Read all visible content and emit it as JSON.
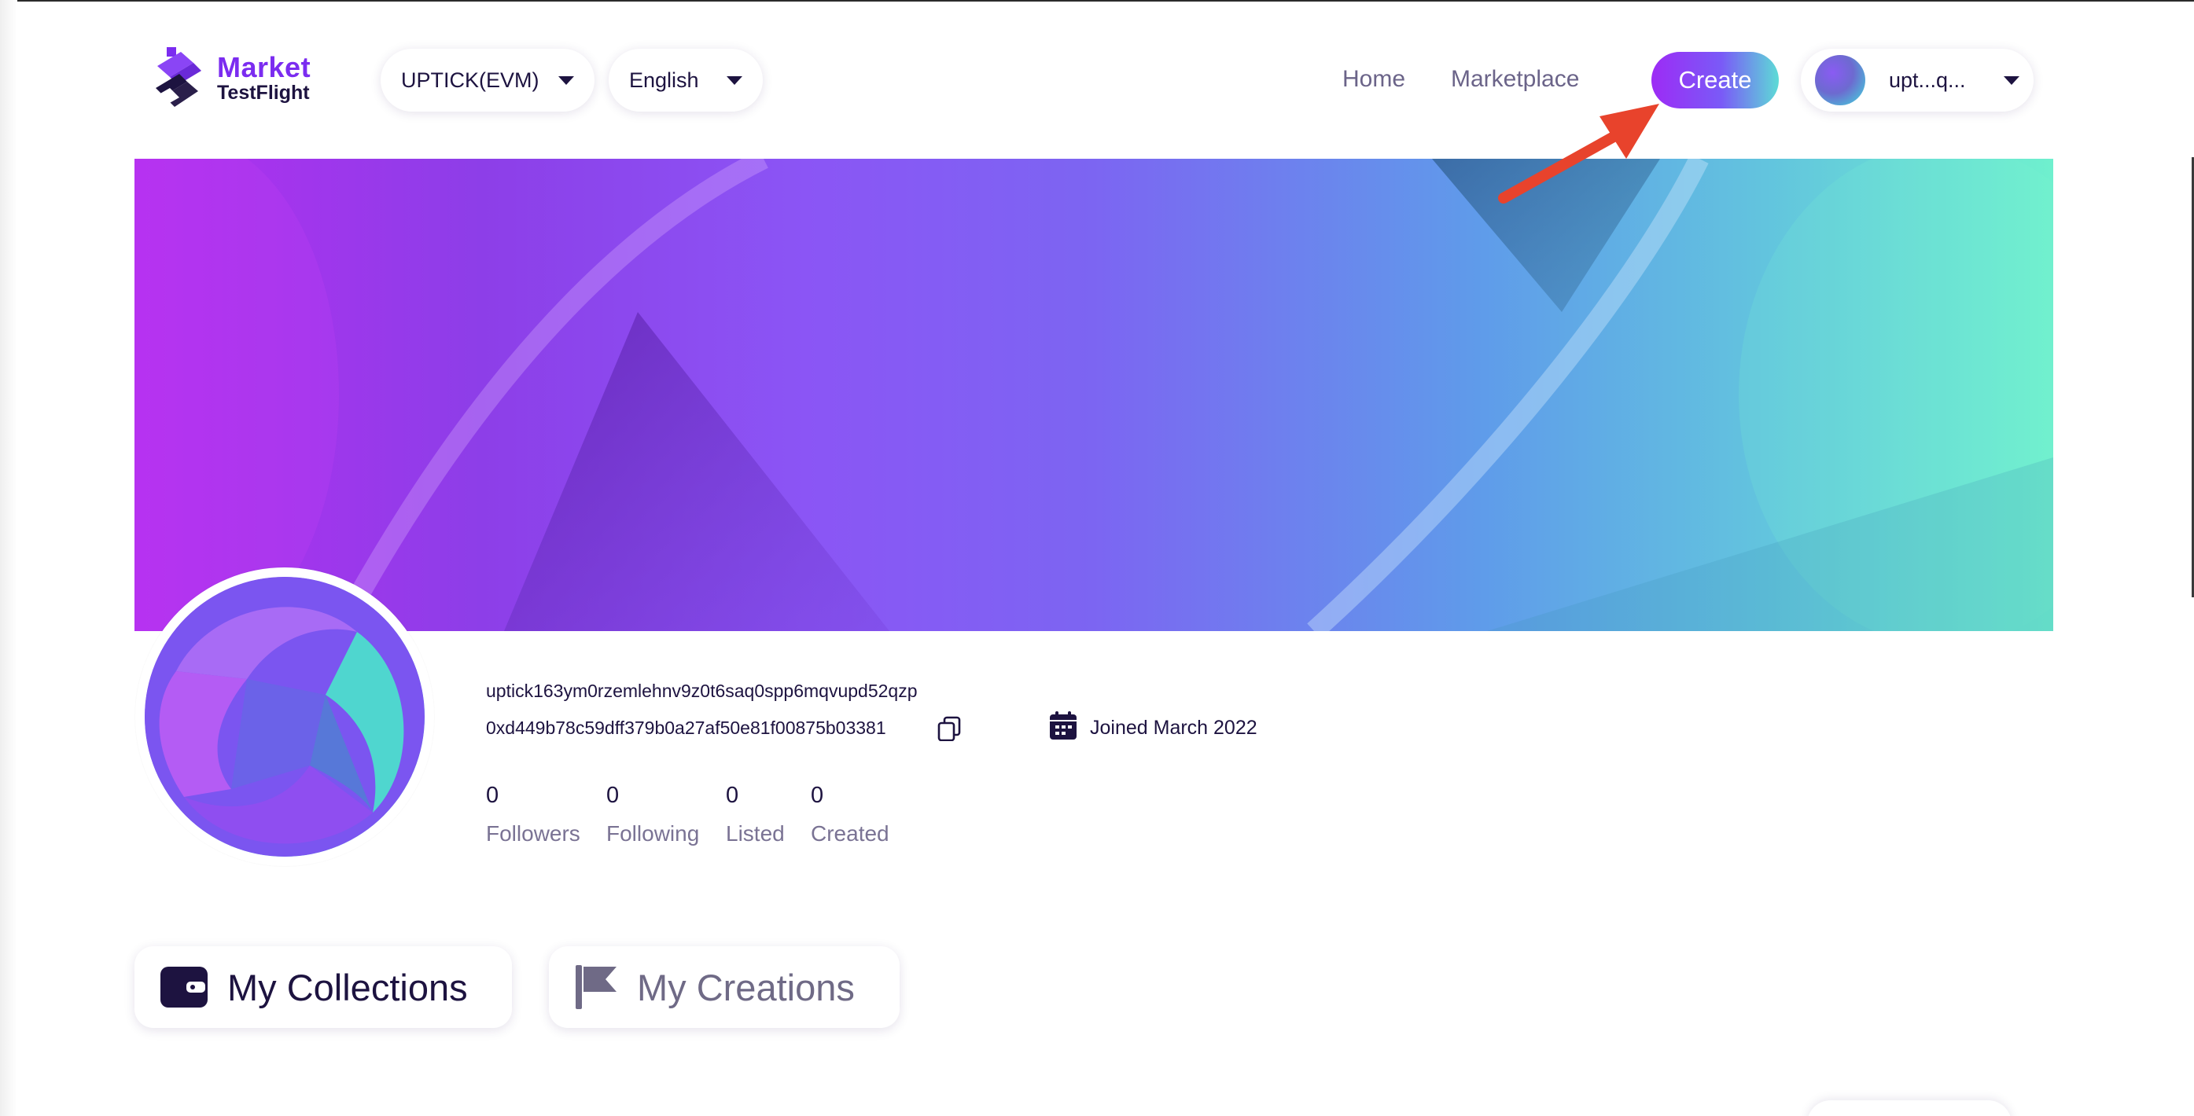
{
  "header": {
    "logo": {
      "line1": "Market",
      "line2": "TestFlight"
    },
    "chain_select": {
      "value": "UPTICK(EVM)"
    },
    "language_select": {
      "value": "English"
    },
    "nav": {
      "home": "Home",
      "marketplace": "Marketplace"
    },
    "create_label": "Create",
    "user": {
      "short_address": "upt...q..."
    }
  },
  "profile": {
    "address_uptick": "uptick163ym0rzemlehnv9z0t6saq0spp6mqvupd52qzp",
    "address_evm": "0xd449b78c59dff379b0a27af50e81f00875b03381",
    "joined": "Joined March 2022",
    "stats": [
      {
        "value": "0",
        "label": "Followers"
      },
      {
        "value": "0",
        "label": "Following"
      },
      {
        "value": "0",
        "label": "Listed"
      },
      {
        "value": "0",
        "label": "Created"
      }
    ]
  },
  "tabs": {
    "collections": "My Collections",
    "creations": "My Creations"
  },
  "colors": {
    "brand_purple": "#7b2cf0",
    "text_dark": "#1d1340",
    "annotation_arrow": "#e8432c"
  },
  "icons": [
    "caret-down-icon",
    "copy-icon",
    "calendar-icon",
    "wallet-icon",
    "flag-icon",
    "annotation-arrow"
  ]
}
